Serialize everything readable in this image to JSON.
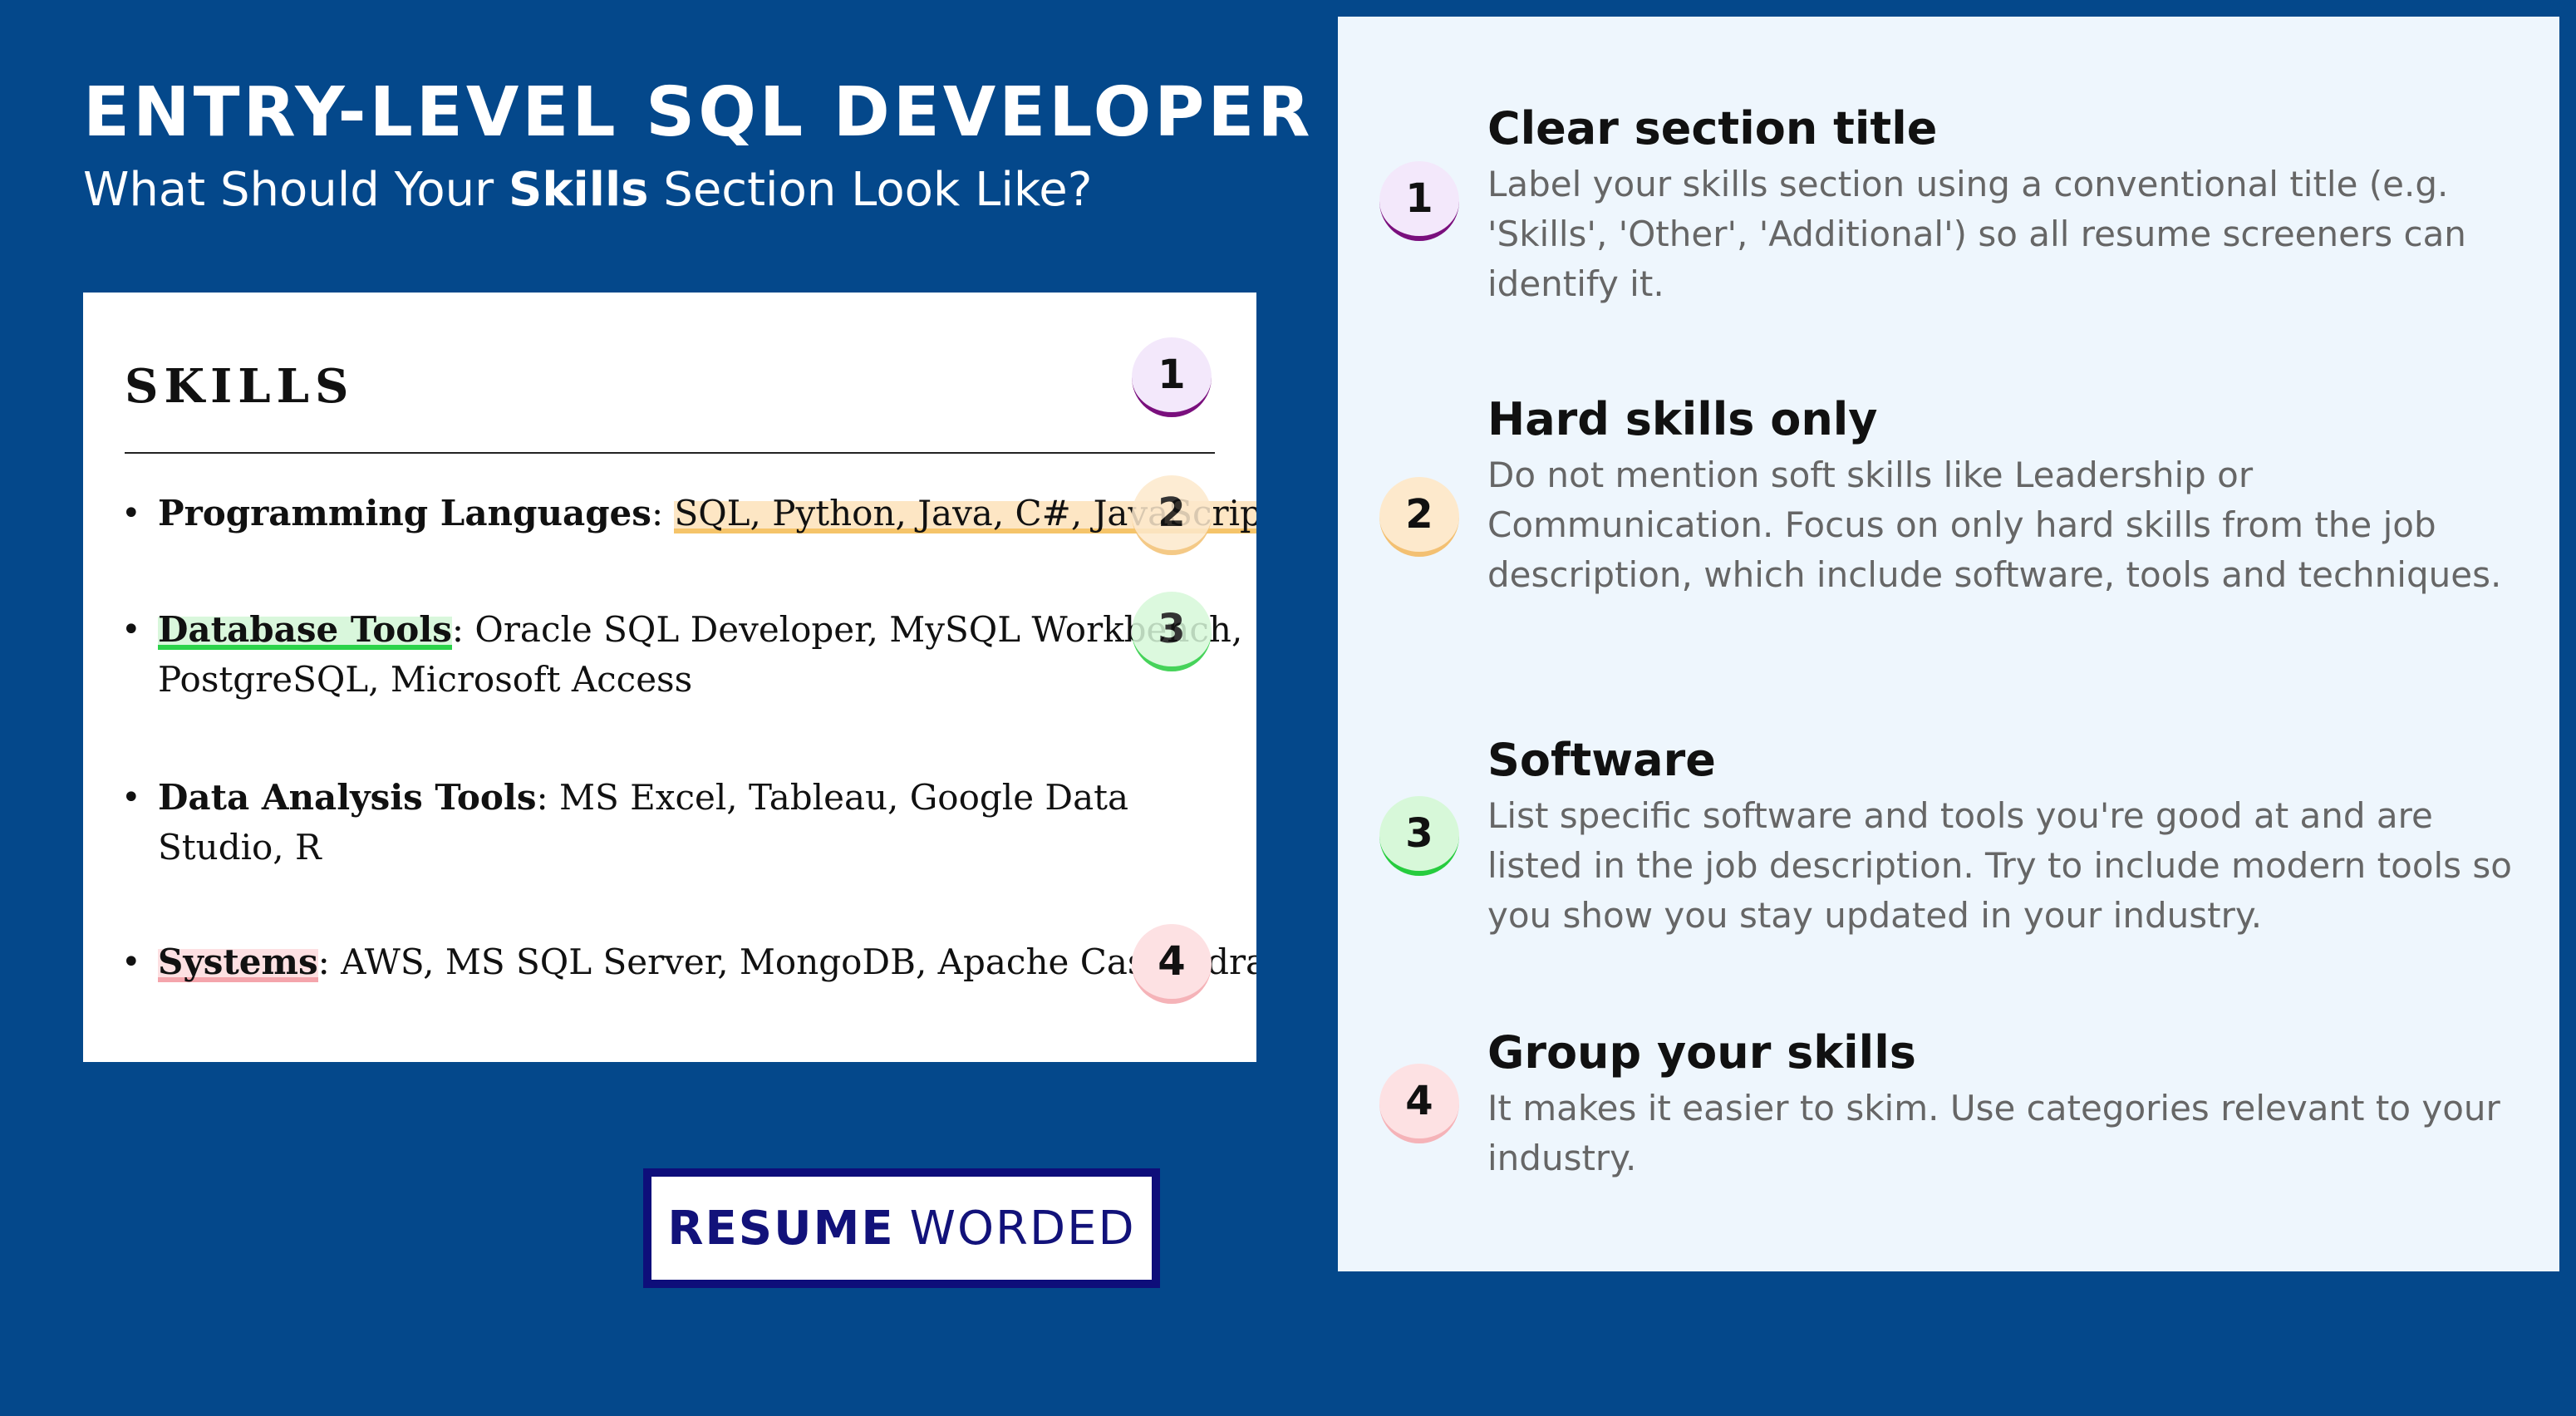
{
  "header": {
    "title": "ENTRY-LEVEL SQL DEVELOPER",
    "subtitle_before": "What Should Your ",
    "subtitle_bold": "Skills",
    "subtitle_after": " Section Look Like?"
  },
  "card": {
    "heading": "SKILLS",
    "skills": [
      {
        "label": "Programming Languages",
        "sep": ": ",
        "value": "SQL, Python, Java, C#, JavaScript",
        "badge": "2"
      },
      {
        "label": "Database Tools",
        "sep": ": ",
        "value": "Oracle SQL Developer, MySQL Workbench,",
        "value2": "PostgreSQL, Microsoft Access",
        "badge": "3"
      },
      {
        "label": "Data Analysis Tools",
        "sep": ": ",
        "value": "MS Excel, Tableau, Google Data",
        "value2": "Studio, R"
      },
      {
        "label": "Systems",
        "sep": ": ",
        "value": "AWS, MS SQL Server, MongoDB, Apache Cassandra",
        "badge": "4"
      }
    ],
    "heading_badge": "1",
    "bullet": "•"
  },
  "logo": {
    "bold": "RESUME",
    "regular": "WORDED"
  },
  "tips": [
    {
      "number": "1",
      "title": "Clear section title",
      "body": "Label your skills section using a conventional title (e.g. 'Skills', 'Other', 'Additional') so all resume screeners can identify it."
    },
    {
      "number": "2",
      "title": "Hard skills only",
      "body": "Do not mention soft skills like Leadership or Communication. Focus on only hard skills from the job description, which include software, tools and techniques."
    },
    {
      "number": "3",
      "title": "Software",
      "body": "List specific software and tools you're good at and are listed in the job description. Try to include modern tools so you show you stay updated in your industry."
    },
    {
      "number": "4",
      "title": "Group your skills",
      "body": "It makes it easier to skim. Use categories relevant to your industry."
    }
  ],
  "colors": {
    "background": "#04488b",
    "panel": "#eef6fd",
    "badge1": "#7a0f7d",
    "badge2": "#f3c072",
    "badge3": "#26cc3e",
    "badge4": "#f5b3b8"
  }
}
